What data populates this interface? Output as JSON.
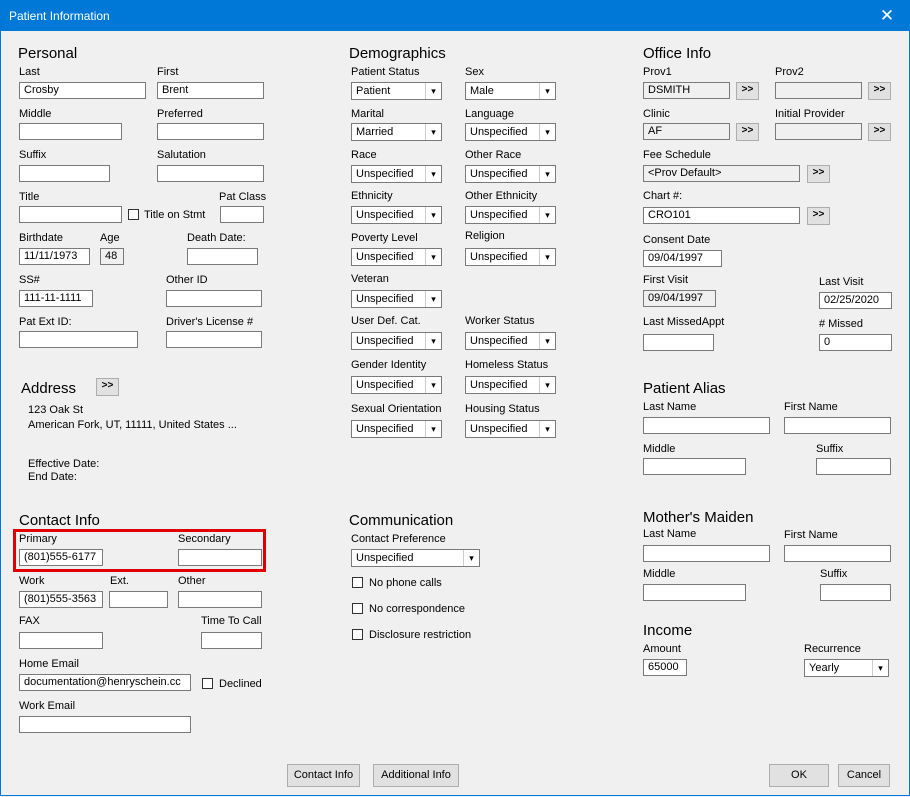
{
  "window": {
    "title": "Patient Information",
    "close_glyph": "✕"
  },
  "personal": {
    "heading": "Personal",
    "last_label": "Last",
    "last": "Crosby",
    "first_label": "First",
    "first": "Brent",
    "middle_label": "Middle",
    "preferred_label": "Preferred",
    "suffix_label": "Suffix",
    "salutation_label": "Salutation",
    "title_label": "Title",
    "title_on_stmt": "Title on Stmt",
    "pat_class_label": "Pat Class",
    "birthdate_label": "Birthdate",
    "birthdate": "11/11/1973",
    "age_label": "Age",
    "age": "48",
    "death_date_label": "Death Date:",
    "ssn_label": "SS#",
    "ssn": "111-11-1111",
    "other_id_label": "Other ID",
    "pat_ext_id_label": "Pat Ext ID:",
    "drivers_license_label": "Driver's License #"
  },
  "address": {
    "heading": "Address",
    "expand": ">>",
    "line1": "123 Oak St",
    "line2": "American Fork, UT, 11111, United States ...",
    "effective_date_label": "Effective Date:",
    "end_date_label": "End Date:"
  },
  "contact": {
    "heading": "Contact Info",
    "primary_label": "Primary",
    "primary": "(801)555-6177",
    "secondary_label": "Secondary",
    "work_label": "Work",
    "work": "(801)555-3563",
    "ext_label": "Ext.",
    "other_label": "Other",
    "fax_label": "FAX",
    "time_to_call_label": "Time To Call",
    "home_email_label": "Home Email",
    "home_email": "documentation@henryschein.cc",
    "declined_label": "Declined",
    "work_email_label": "Work Email"
  },
  "demographics": {
    "heading": "Demographics",
    "patient_status_label": "Patient Status",
    "patient_status": "Patient",
    "sex_label": "Sex",
    "sex": "Male",
    "marital_label": "Marital",
    "marital": "Married",
    "language_label": "Language",
    "language": "Unspecified",
    "race_label": "Race",
    "race": "Unspecified",
    "other_race_label": "Other Race",
    "other_race": "Unspecified",
    "ethnicity_label": "Ethnicity",
    "ethnicity": "Unspecified",
    "other_ethnicity_label": "Other Ethnicity",
    "other_ethnicity": "Unspecified",
    "poverty_level_label": "Poverty Level",
    "poverty_level": "Unspecified",
    "religion_label": "Religion",
    "religion": "Unspecified",
    "veteran_label": "Veteran",
    "veteran": "Unspecified",
    "user_def_cat_label": "User Def. Cat.",
    "user_def_cat": "Unspecified",
    "worker_status_label": "Worker Status",
    "worker_status": "Unspecified",
    "gender_identity_label": "Gender Identity",
    "gender_identity": "Unspecified",
    "homeless_status_label": "Homeless Status",
    "homeless_status": "Unspecified",
    "sexual_orientation_label": "Sexual Orientation",
    "sexual_orientation": "Unspecified",
    "housing_status_label": "Housing Status",
    "housing_status": "Unspecified"
  },
  "communication": {
    "heading": "Communication",
    "contact_pref_label": "Contact Preference",
    "contact_pref": "Unspecified",
    "no_phone_calls": "No phone calls",
    "no_correspondence": "No correspondence",
    "disclosure_restriction": "Disclosure restriction"
  },
  "office": {
    "heading": "Office Info",
    "prov1_label": "Prov1",
    "prov1": "DSMITH",
    "prov2_label": "Prov2",
    "clinic_label": "Clinic",
    "clinic": "AF",
    "initial_provider_label": "Initial Provider",
    "fee_schedule_label": "Fee Schedule",
    "fee_schedule": "<Prov Default>",
    "chart_label": "Chart #:",
    "chart": "CRO101",
    "consent_date_label": "Consent Date",
    "consent_date": "09/04/1997",
    "first_visit_label": "First Visit",
    "first_visit": "09/04/1997",
    "last_visit_label": "Last Visit",
    "last_visit": "02/25/2020",
    "last_missed_label": "Last MissedAppt",
    "missed_label": "# Missed",
    "missed": "0",
    "expand": ">>"
  },
  "alias": {
    "heading": "Patient Alias",
    "last_label": "Last Name",
    "first_label": "First Name",
    "middle_label": "Middle",
    "suffix_label": "Suffix"
  },
  "maiden": {
    "heading": "Mother's Maiden",
    "last_label": "Last Name",
    "first_label": "First Name",
    "middle_label": "Middle",
    "suffix_label": "Suffix"
  },
  "income": {
    "heading": "Income",
    "amount_label": "Amount",
    "amount": "65000",
    "recurrence_label": "Recurrence",
    "recurrence": "Yearly"
  },
  "footer": {
    "contact_info": "Contact Info",
    "additional_info": "Additional Info",
    "ok": "OK",
    "cancel": "Cancel"
  },
  "icons": {
    "dropdown": "▾"
  }
}
